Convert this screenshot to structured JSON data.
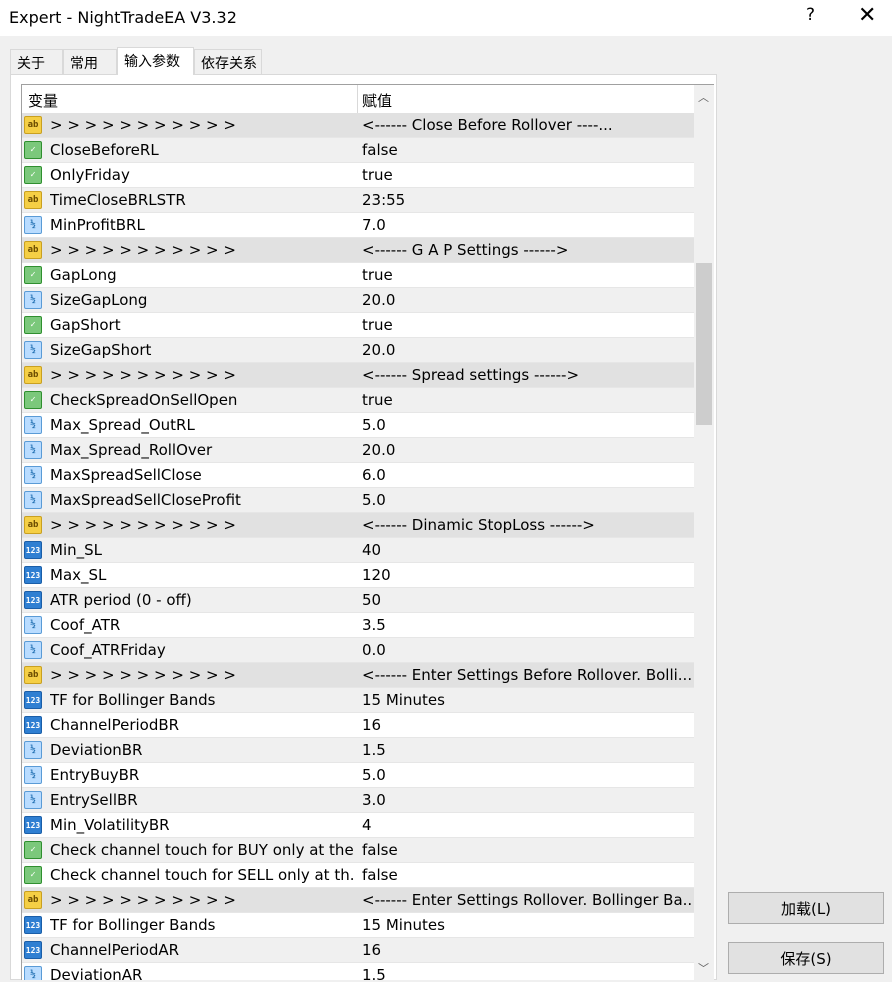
{
  "window": {
    "title": "Expert - NightTradeEA V3.32",
    "help_label": "?",
    "close_label": "✕"
  },
  "tabs": [
    {
      "label": "关于"
    },
    {
      "label": "常用"
    },
    {
      "label": "输入参数"
    },
    {
      "label": "依存关系"
    }
  ],
  "grid": {
    "col_variable": "变量",
    "col_value": "赋值",
    "rows": [
      {
        "type": "string",
        "name": "> > > > > > > > > > >",
        "value": "<------        Close Before Rollover    ----..."
      },
      {
        "type": "bool",
        "name": "CloseBeforeRL",
        "value": "false"
      },
      {
        "type": "bool",
        "name": "OnlyFriday",
        "value": "true"
      },
      {
        "type": "string",
        "name": "TimeCloseBRLSTR",
        "value": "23:55"
      },
      {
        "type": "double",
        "name": "MinProfitBRL",
        "value": "7.0"
      },
      {
        "type": "string",
        "name": "> > > > > > > > > > >",
        "value": "<------         G A P  Settings          ------>"
      },
      {
        "type": "bool",
        "name": "GapLong",
        "value": "true"
      },
      {
        "type": "double",
        "name": "SizeGapLong",
        "value": "20.0"
      },
      {
        "type": "bool",
        "name": "GapShort",
        "value": "true"
      },
      {
        "type": "double",
        "name": "SizeGapShort",
        "value": "20.0"
      },
      {
        "type": "string",
        "name": "> > > > > > > > > > >",
        "value": "<------          Spread settings          ------>"
      },
      {
        "type": "bool",
        "name": "CheckSpreadOnSellOpen",
        "value": "true"
      },
      {
        "type": "double",
        "name": "Max_Spread_OutRL",
        "value": "5.0"
      },
      {
        "type": "double",
        "name": "Max_Spread_RollOver",
        "value": "20.0"
      },
      {
        "type": "double",
        "name": "MaxSpreadSellClose",
        "value": "6.0"
      },
      {
        "type": "double",
        "name": "MaxSpreadSellCloseProfit",
        "value": "5.0"
      },
      {
        "type": "string",
        "name": "> > > > > > > > > > >",
        "value": "<------        Dinamic StopLoss         ------>"
      },
      {
        "type": "int",
        "name": "Min_SL",
        "value": "40"
      },
      {
        "type": "int",
        "name": "Max_SL",
        "value": "120"
      },
      {
        "type": "int",
        "name": "ATR period (0 - off)",
        "value": "50"
      },
      {
        "type": "double",
        "name": "Coof_ATR",
        "value": "3.5"
      },
      {
        "type": "double",
        "name": "Coof_ATRFriday",
        "value": "0.0"
      },
      {
        "type": "string",
        "name": "> > > > > > > > > > >",
        "value": "<------ Enter Settings Before Rollover. Bolli..."
      },
      {
        "type": "int",
        "name": "TF for Bollinger Bands",
        "value": "15 Minutes"
      },
      {
        "type": "int",
        "name": "ChannelPeriodBR",
        "value": "16"
      },
      {
        "type": "double",
        "name": "DeviationBR",
        "value": "1.5"
      },
      {
        "type": "double",
        "name": "EntryBuyBR",
        "value": "5.0"
      },
      {
        "type": "double",
        "name": "EntrySellBR",
        "value": "3.0"
      },
      {
        "type": "int",
        "name": "Min_VolatilityBR",
        "value": "4"
      },
      {
        "type": "bool",
        "name": "Check channel touch for BUY only at the...",
        "value": "false"
      },
      {
        "type": "bool",
        "name": "Check channel touch for SELL only at th...",
        "value": "false"
      },
      {
        "type": "string",
        "name": "> > > > > > > > > > >",
        "value": "<------ Enter Settings Rollover. Bollinger Ba..."
      },
      {
        "type": "int",
        "name": "TF for Bollinger Bands",
        "value": "15 Minutes"
      },
      {
        "type": "int",
        "name": "ChannelPeriodAR",
        "value": "16"
      },
      {
        "type": "double",
        "name": "DeviationAR",
        "value": "1.5"
      }
    ]
  },
  "icons": {
    "string": {
      "name": "string-type-icon",
      "glyph": "ab"
    },
    "bool": {
      "name": "bool-type-icon",
      "glyph": "✓"
    },
    "double": {
      "name": "double-type-icon",
      "glyph": "½"
    },
    "int": {
      "name": "int-type-icon",
      "glyph": "123"
    }
  },
  "buttons": {
    "load_label": "加载(L)",
    "save_label": "保存(S)"
  }
}
